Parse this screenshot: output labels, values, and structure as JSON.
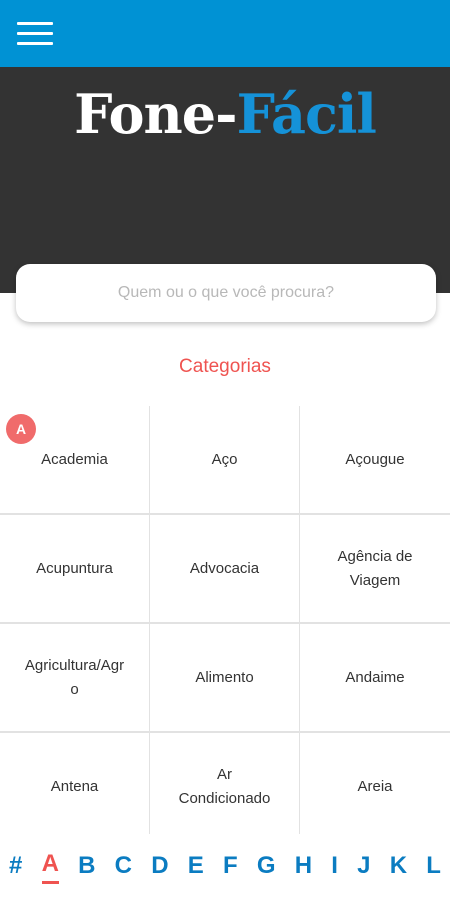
{
  "header": {
    "menu_icon": "hamburger-menu-icon"
  },
  "logo": {
    "part1": "Fone-",
    "part2": "Fácil"
  },
  "search": {
    "placeholder": "Quem ou o que você procura?"
  },
  "categories_title": "Categorias",
  "current_letter": "A",
  "categories": [
    [
      "Academia",
      "Aço",
      "Açougue"
    ],
    [
      "Acupuntura",
      "Advocacia",
      "Agência de Viagem"
    ],
    [
      "Agricultura/Agro",
      "Alimento",
      "Andaime"
    ],
    [
      "Antena",
      "Ar Condicionado",
      "Areia"
    ]
  ],
  "alphabet": [
    "#",
    "A",
    "B",
    "C",
    "D",
    "E",
    "F",
    "G",
    "H",
    "I",
    "J",
    "K",
    "L"
  ],
  "active_alphabet": "A",
  "colors": {
    "topbar": "#0092d4",
    "hero": "#333333",
    "accent_red": "#ef5350",
    "alphabet_blue": "#0b7cc1"
  }
}
